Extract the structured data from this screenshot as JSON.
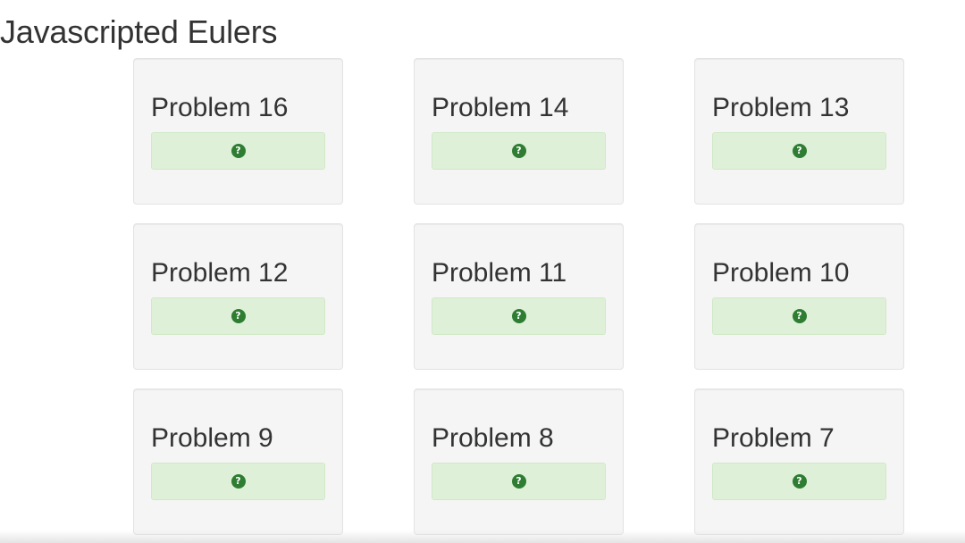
{
  "header": {
    "title": "Javascripted Eulers"
  },
  "problems": [
    {
      "title": "Problem 16",
      "status_icon": "question-circle-icon"
    },
    {
      "title": "Problem 14",
      "status_icon": "question-circle-icon"
    },
    {
      "title": "Problem 13",
      "status_icon": "question-circle-icon"
    },
    {
      "title": "Problem 12",
      "status_icon": "question-circle-icon"
    },
    {
      "title": "Problem 11",
      "status_icon": "question-circle-icon"
    },
    {
      "title": "Problem 10",
      "status_icon": "question-circle-icon"
    },
    {
      "title": "Problem 9",
      "status_icon": "question-circle-icon"
    },
    {
      "title": "Problem 8",
      "status_icon": "question-circle-icon"
    },
    {
      "title": "Problem 7",
      "status_icon": "question-circle-icon"
    }
  ],
  "colors": {
    "card_background": "#f5f5f5",
    "status_background": "#dff0d8",
    "icon_color": "#2e7d32",
    "text_color": "#333333"
  }
}
